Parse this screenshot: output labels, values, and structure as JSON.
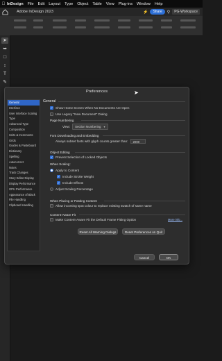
{
  "menubar": {
    "items": [
      "InDesign",
      "File",
      "Edit",
      "Layout",
      "Type",
      "Object",
      "Table",
      "View",
      "Plug-ins",
      "Window",
      "Help"
    ]
  },
  "appbar": {
    "title": "Adobe InDesign 2023",
    "share_label": "Share",
    "workspace": "PG-Workspace"
  },
  "dialog": {
    "title": "Preferences",
    "sidebar": [
      "General",
      "Interface",
      "User Interface Scaling",
      "Type",
      "Advanced Type",
      "Composition",
      "Units & Increments",
      "Grids",
      "Guides & Pasteboard",
      "Dictionary",
      "Spelling",
      "Autocorrect",
      "Notes",
      "Track Changes",
      "Story Editor Display",
      "Display Performance",
      "GPU Performance",
      "Appearance of Black",
      "File Handling",
      "Clipboard Handling"
    ],
    "selected_index": 0,
    "general_header": "General",
    "show_home_screen": "Show Home Screen When No Documents Are Open",
    "use_legacy": "Use Legacy \"New Document\" Dialog",
    "page_numbering": {
      "header": "Page Numbering",
      "view_label": "View:",
      "view_value": "Section Numbering"
    },
    "font_embedding": {
      "header": "Font Downloading and Embedding",
      "subset_label": "Always subset fonts with glyph counts greater than:",
      "subset_value": "2000"
    },
    "object_editing": {
      "header": "Object Editing",
      "prevent_locked": "Prevent Selection of Locked Objects"
    },
    "when_scaling": {
      "header": "When Scaling:",
      "apply_to_content": "Apply to Content",
      "include_stroke": "Include Stroke Weight",
      "include_effects": "Include Effects",
      "adjust_scaling": "Adjust Scaling Percentage"
    },
    "placing": {
      "header": "When Placing or Pasting Content",
      "allow_spot": "Allow incoming spot colour to replace existing swatch of same name"
    },
    "content_aware": {
      "header": "Content-Aware Fit",
      "make_default": "Make Content-Aware Fit the Default Frame Fitting Option",
      "more_info": "More info..."
    },
    "buttons": {
      "reset_warnings": "Reset All Warning Dialogs",
      "reset_prefs": "Reset Preferences on Quit",
      "cancel": "Cancel",
      "ok": "OK"
    }
  },
  "colors": {
    "accent": "#2f6fd8",
    "dialog_bg": "#2d2d2d",
    "app_bg": "#1b1b1b"
  }
}
